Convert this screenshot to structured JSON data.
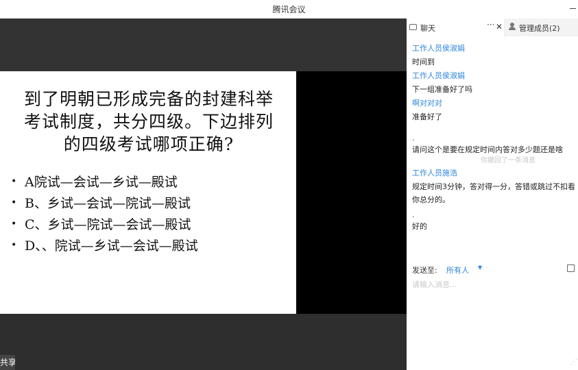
{
  "window": {
    "title": "腾讯会议"
  },
  "slide": {
    "question_lines": [
      "到了明朝已形成完备的封建科举",
      "考试制度，共分四级。下边排列",
      "的四级考试哪项正确?"
    ],
    "options": [
      "A院试—会试—乡试—殿试",
      "B、乡试—会试—院试—殿试",
      "C、乡试—院试—会试—殿试",
      "D、、院试—乡试—会试—殿试"
    ]
  },
  "share_button": {
    "label": "共享"
  },
  "panel": {
    "tabs": {
      "chat": "聊天",
      "more": "···",
      "close": "✕",
      "members": "管理成员(2)"
    },
    "messages": {
      "m1_name": "工作人员侯淑娟",
      "m1_text": "时间到",
      "m2_name": "工作人员侯淑娟",
      "m2_text": "下一组准备好了吗",
      "m3_name": "啊对对对",
      "m3_text": "准备好了",
      "m4_dot": ".",
      "m4_text": "请问这个是要在规定时间内答对多少题还是啥",
      "m4_faded": "你撤回了一条消息",
      "m5_name": "工作人员施浩",
      "m5_text": "规定时间3分钟，答对得一分，答错或跳过不扣看你总分的。",
      "m6_dot": ".",
      "m6_text": "好的"
    },
    "send": {
      "label": "发送至:",
      "target": "所有人",
      "caret": "▼"
    },
    "input_placeholder": "请输入消息..."
  },
  "colors": {
    "accent": "#2e86de",
    "stage_dark": "#2b2b2b",
    "slide_bg": "#ffffff"
  },
  "icons": [
    "minimize-icon",
    "chat-icon",
    "more-icon",
    "close-icon",
    "person-icon",
    "file-icon"
  ]
}
